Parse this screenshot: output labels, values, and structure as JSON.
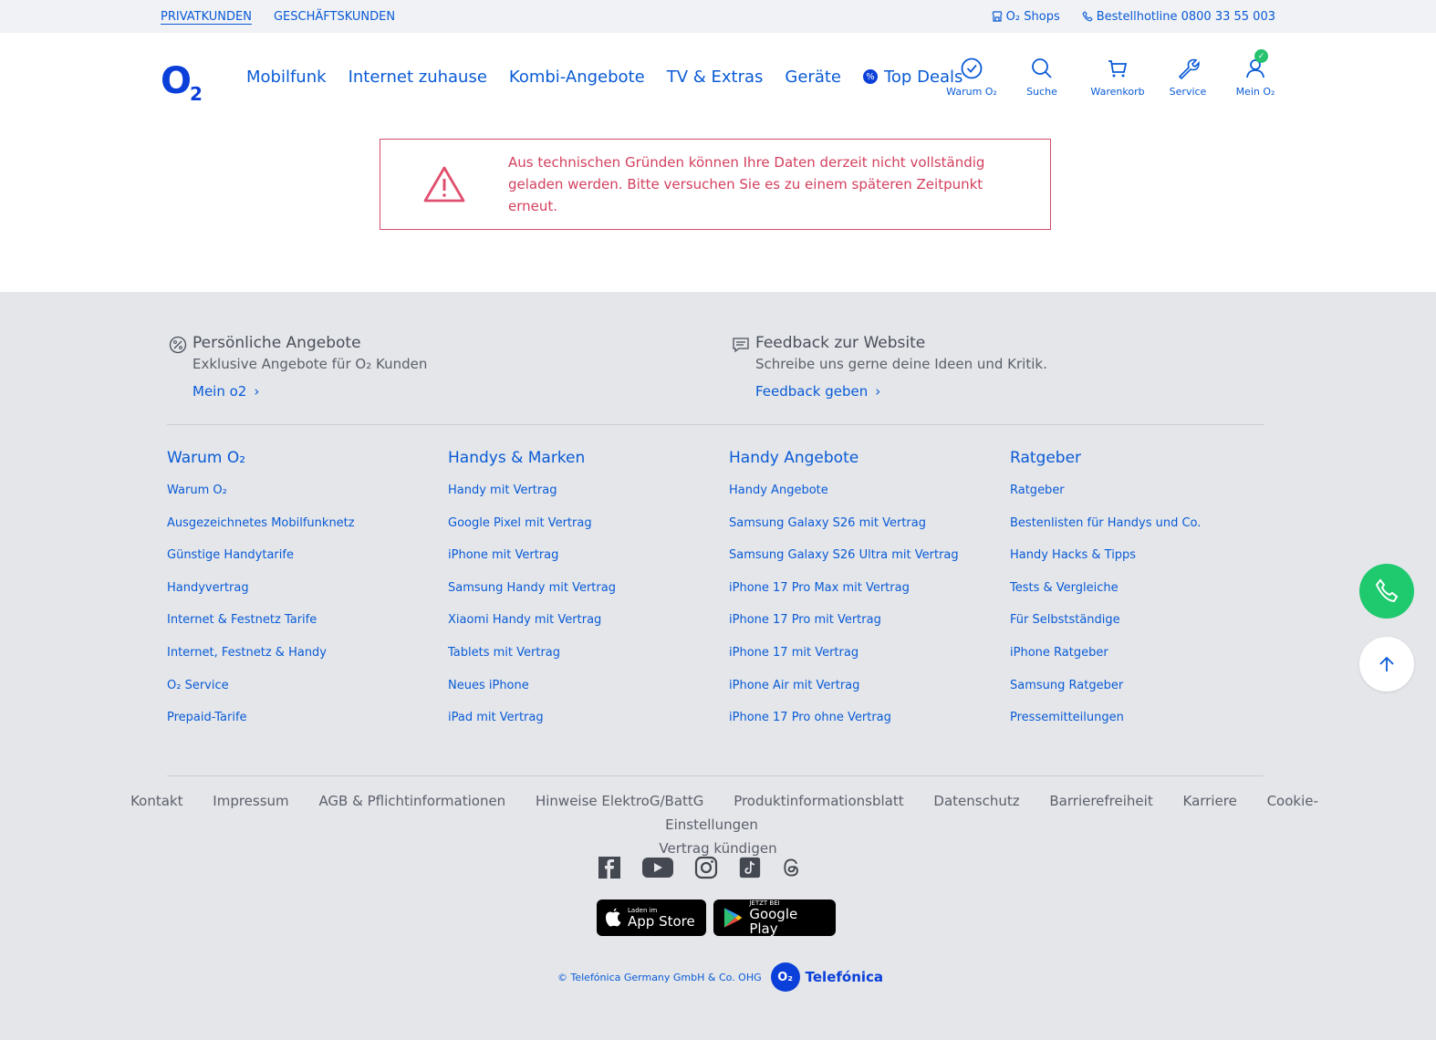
{
  "topbar": {
    "segments": [
      "PRIVATKUNDEN",
      "GESCHÄFTSKUNDEN"
    ],
    "shops": "O₂ Shops",
    "hotline": "Bestellhotline 0800 33 55 003"
  },
  "header": {
    "logo": "O",
    "logo_sub": "2",
    "nav": [
      "Mobilfunk",
      "Internet zuhause",
      "Kombi-Angebote",
      "TV & Extras",
      "Geräte",
      "Top Deals"
    ],
    "deal_badge": "%",
    "icons": [
      {
        "label": "Warum O₂",
        "icon": "check-circle-icon"
      },
      {
        "label": "Suche",
        "icon": "search-icon"
      },
      {
        "label": "Warenkorb",
        "icon": "cart-icon"
      },
      {
        "label": "Service",
        "icon": "wrench-icon"
      },
      {
        "label": "Mein O₂",
        "icon": "user-icon"
      }
    ]
  },
  "alert": {
    "message": "Aus technischen Gründen können Ihre Daten derzeit nicht vollständig geladen werden. Bitte versuchen Sie es zu einem späteren Zeitpunkt erneut."
  },
  "promos": [
    {
      "title": "Persönliche Angebote",
      "text": "Exklusive Angebote für O₂ Kunden",
      "link": "Mein o2"
    },
    {
      "title": "Feedback zur Website",
      "text": "Schreibe uns gerne deine Ideen und Kritik.",
      "link": "Feedback geben"
    }
  ],
  "columns": [
    {
      "title": "Warum O₂",
      "items": [
        "Warum O₂",
        "Ausgezeichnetes Mobilfunknetz",
        "Günstige Handytarife",
        "Handyvertrag",
        "Internet & Festnetz Tarife",
        "Internet, Festnetz & Handy",
        "O₂ Service",
        "Prepaid-Tarife"
      ]
    },
    {
      "title": "Handys & Marken",
      "items": [
        "Handy mit Vertrag",
        "Google Pixel mit Vertrag",
        "iPhone mit Vertrag",
        "Samsung Handy mit Vertrag",
        "Xiaomi Handy mit Vertrag",
        "Tablets mit Vertrag",
        "Neues iPhone",
        "iPad mit Vertrag"
      ]
    },
    {
      "title": "Handy Angebote",
      "items": [
        "Handy Angebote",
        "Samsung Galaxy S26 mit Vertrag",
        "Samsung Galaxy S26 Ultra mit Vertrag",
        "iPhone 17 Pro Max mit Vertrag",
        "iPhone 17 Pro mit Vertrag",
        "iPhone 17 mit Vertrag",
        "iPhone Air mit Vertrag",
        "iPhone 17 Pro ohne Vertrag"
      ]
    },
    {
      "title": "Ratgeber",
      "items": [
        "Ratgeber",
        "Bestenlisten für Handys und Co.",
        "Handy Hacks & Tipps",
        "Tests & Vergleiche",
        "Für Selbstständige",
        "iPhone Ratgeber",
        "Samsung Ratgeber",
        "Pressemitteilungen"
      ]
    }
  ],
  "legal": [
    "Kontakt",
    "Impressum",
    "AGB & Pflichtinformationen",
    "Hinweise ElektroG/BattG",
    "Produktinformationsblatt",
    "Datenschutz",
    "Barrierefreiheit",
    "Karriere",
    "Cookie-Einstellungen",
    "Vertrag kündigen"
  ],
  "social": [
    "facebook-icon",
    "youtube-icon",
    "instagram-icon",
    "tiktok-icon",
    "threads-icon"
  ],
  "stores": {
    "apple_small": "Laden im",
    "apple_big": "App Store",
    "google_small": "JETZT BEI",
    "google_big": "Google Play"
  },
  "footer": {
    "copyright": "© Telefónica Germany GmbH & Co. OHG",
    "telefonica": "Telefónica",
    "telefonica_logo": "O₂"
  },
  "colors": {
    "brand": "#0a3fd9",
    "link": "#0a5bd6",
    "error": "#d3405e",
    "call_button": "#1fc96e"
  }
}
